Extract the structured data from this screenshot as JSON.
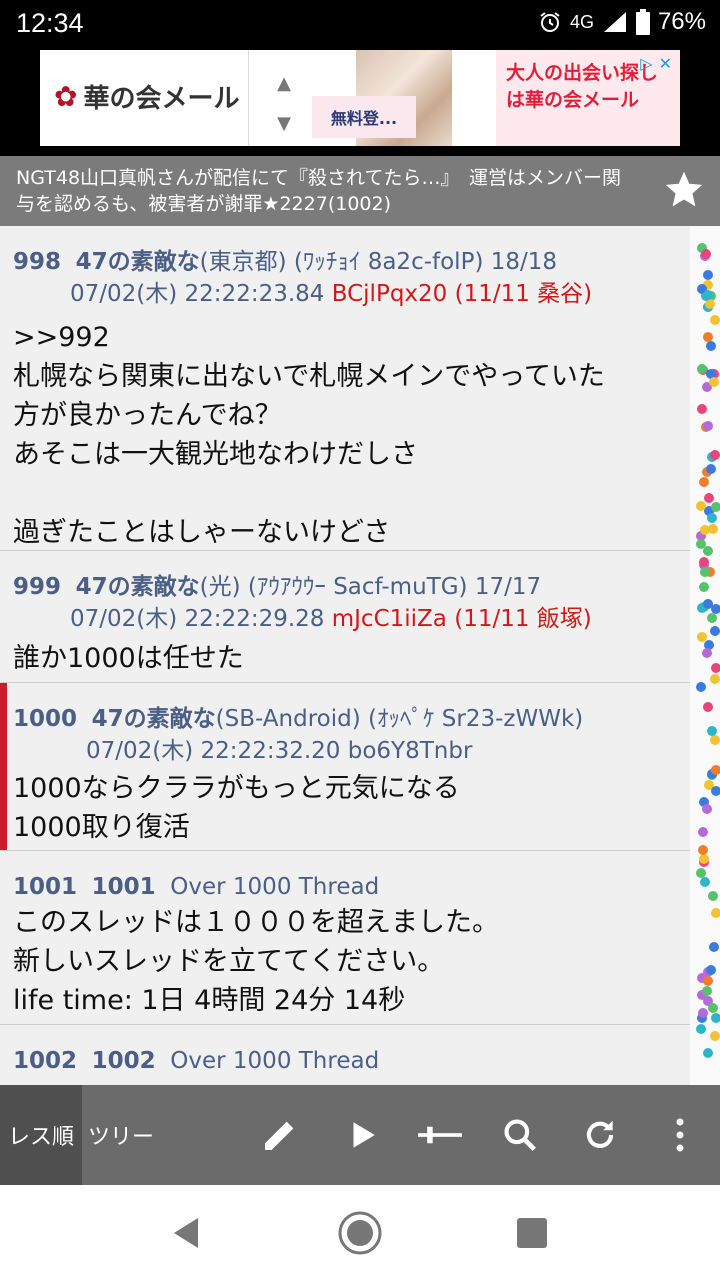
{
  "status": {
    "time": "12:34",
    "network": "4G",
    "battery": "76%"
  },
  "ad": {
    "brand": "華の会メール",
    "free_label": "無料登...",
    "copy_line1": "大人の出会い探し",
    "copy_line2": "は華の会メール"
  },
  "thread": {
    "title": "NGT48山口真帆さんが配信にて『殺されてたら…』　運営はメンバー関与を認めるも、被害者が謝罪★2227(1002)"
  },
  "posts": [
    {
      "num": "998",
      "name": "47の素敵な",
      "region": "(東京都)",
      "meta": "(ﾜｯﾁｮｲ 8a2c-folP) 18/18",
      "datetime": "07/02(木) 22:22:23.84",
      "id": "BCjlPqx20",
      "count": "(11/11 桑谷)",
      "body": ">>992\n札幌なら関東に出ないで札幌メインでやっていた\n方が良かったんでね？\nあそこは一大観光地なわけだしさ\n\n過ぎたことはしゃーないけどさ"
    },
    {
      "num": "999",
      "name": "47の素敵な",
      "region": "(光)",
      "meta": "(ｱｳｱｳｳｰ Sacf-muTG) 17/17",
      "datetime": "07/02(木) 22:22:29.28",
      "id": "mJcC1iiZa",
      "count": "(11/11 飯塚)",
      "body": "誰か1000は任せた"
    },
    {
      "num": "1000",
      "name": "47の素敵な",
      "region": "(SB-Android)",
      "meta": "(ｵｯﾍﾟｹ Sr23-zWWk)",
      "datetime": "07/02(木) 22:22:32.20",
      "id": "bo6Y8Tnbr",
      "count": "",
      "body": "1000ならクララがもっと元気になる\n1000取り復活"
    },
    {
      "num": "1001",
      "name": "1001",
      "region": "",
      "meta": "Over 1000 Thread",
      "datetime": "",
      "id": "",
      "count": "",
      "body": "このスレッドは１０００を超えました。\n新しいスレッドを立ててください。\nlife time: 1日 4時間 24分 14秒"
    },
    {
      "num": "1002",
      "name": "1002",
      "region": "",
      "meta": "Over 1000 Thread",
      "datetime": "",
      "id": "",
      "count": "",
      "body": ""
    }
  ],
  "toolbar": {
    "tab_order": "レス順",
    "tab_tree": "ツリー",
    "icons": [
      "pencil-icon",
      "play-icon",
      "slider-icon",
      "search-icon",
      "refresh-icon",
      "more-icon"
    ]
  },
  "colors": {
    "accent_red": "#d11818",
    "header_blue": "#4a5e86",
    "toolbar": "#6b6b6b"
  }
}
